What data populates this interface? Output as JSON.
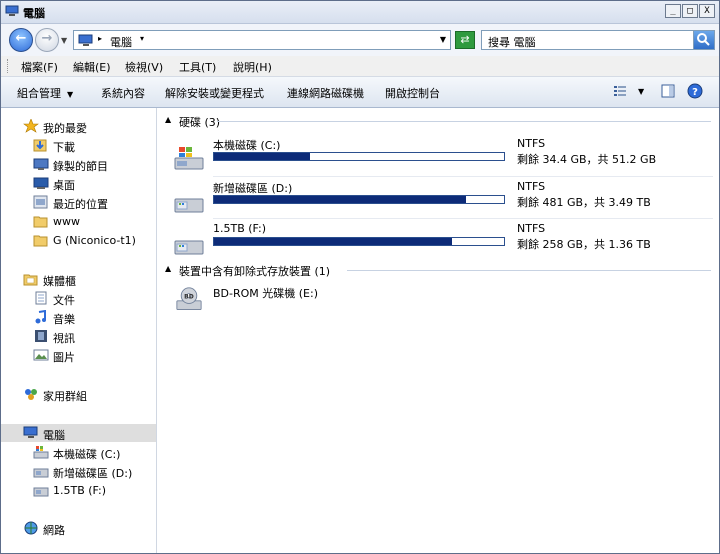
{
  "window": {
    "title": "電腦",
    "minimize": "_",
    "maximize": "□",
    "close": "X"
  },
  "address": {
    "crumb": "電腦",
    "search_placeholder": "搜尋 電腦"
  },
  "menu": [
    "檔案(F)",
    "編輯(E)",
    "檢視(V)",
    "工具(T)",
    "說明(H)"
  ],
  "commands": [
    "組合管理",
    "系統內容",
    "解除安裝或變更程式",
    "連線網路磁碟機",
    "開啟控制台"
  ],
  "sidebar": {
    "favorites": {
      "header": "我的最愛",
      "items": [
        "下載",
        "錄製的節目",
        "桌面",
        "最近的位置",
        "www",
        "G (Niconico-t1)"
      ]
    },
    "libraries": {
      "header": "媒體櫃",
      "items": [
        "文件",
        "音樂",
        "視訊",
        "圖片"
      ]
    },
    "homegroup": "家用群組",
    "computer": {
      "header": "電腦",
      "items": [
        "本機磁碟 (C:)",
        "新增磁碟區 (D:)",
        "1.5TB (F:)"
      ]
    },
    "network": "網路"
  },
  "groups": {
    "hdd": {
      "label": "硬碟 (3)"
    },
    "removable": {
      "label": "裝置中含有卸除式存放裝置 (1)"
    }
  },
  "drives": [
    {
      "name": "本機磁碟 (C:)",
      "fs": "NTFS",
      "free_text": "剩餘 34.4 GB，共 51.2 GB",
      "used_fraction": 0.33
    },
    {
      "name": "新增磁碟區 (D:)",
      "fs": "NTFS",
      "free_text": "剩餘 481 GB，共 3.49 TB",
      "used_fraction": 0.87
    },
    {
      "name": "1.5TB (F:)",
      "fs": "NTFS",
      "free_text": "剩餘 258 GB，共 1.36 TB",
      "used_fraction": 0.82
    }
  ],
  "removable": [
    {
      "name": "BD-ROM 光碟機 (E:)",
      "badge": "BD"
    }
  ],
  "colors": {
    "bar_fill": "#0d2b78",
    "selection": "#dedede"
  }
}
